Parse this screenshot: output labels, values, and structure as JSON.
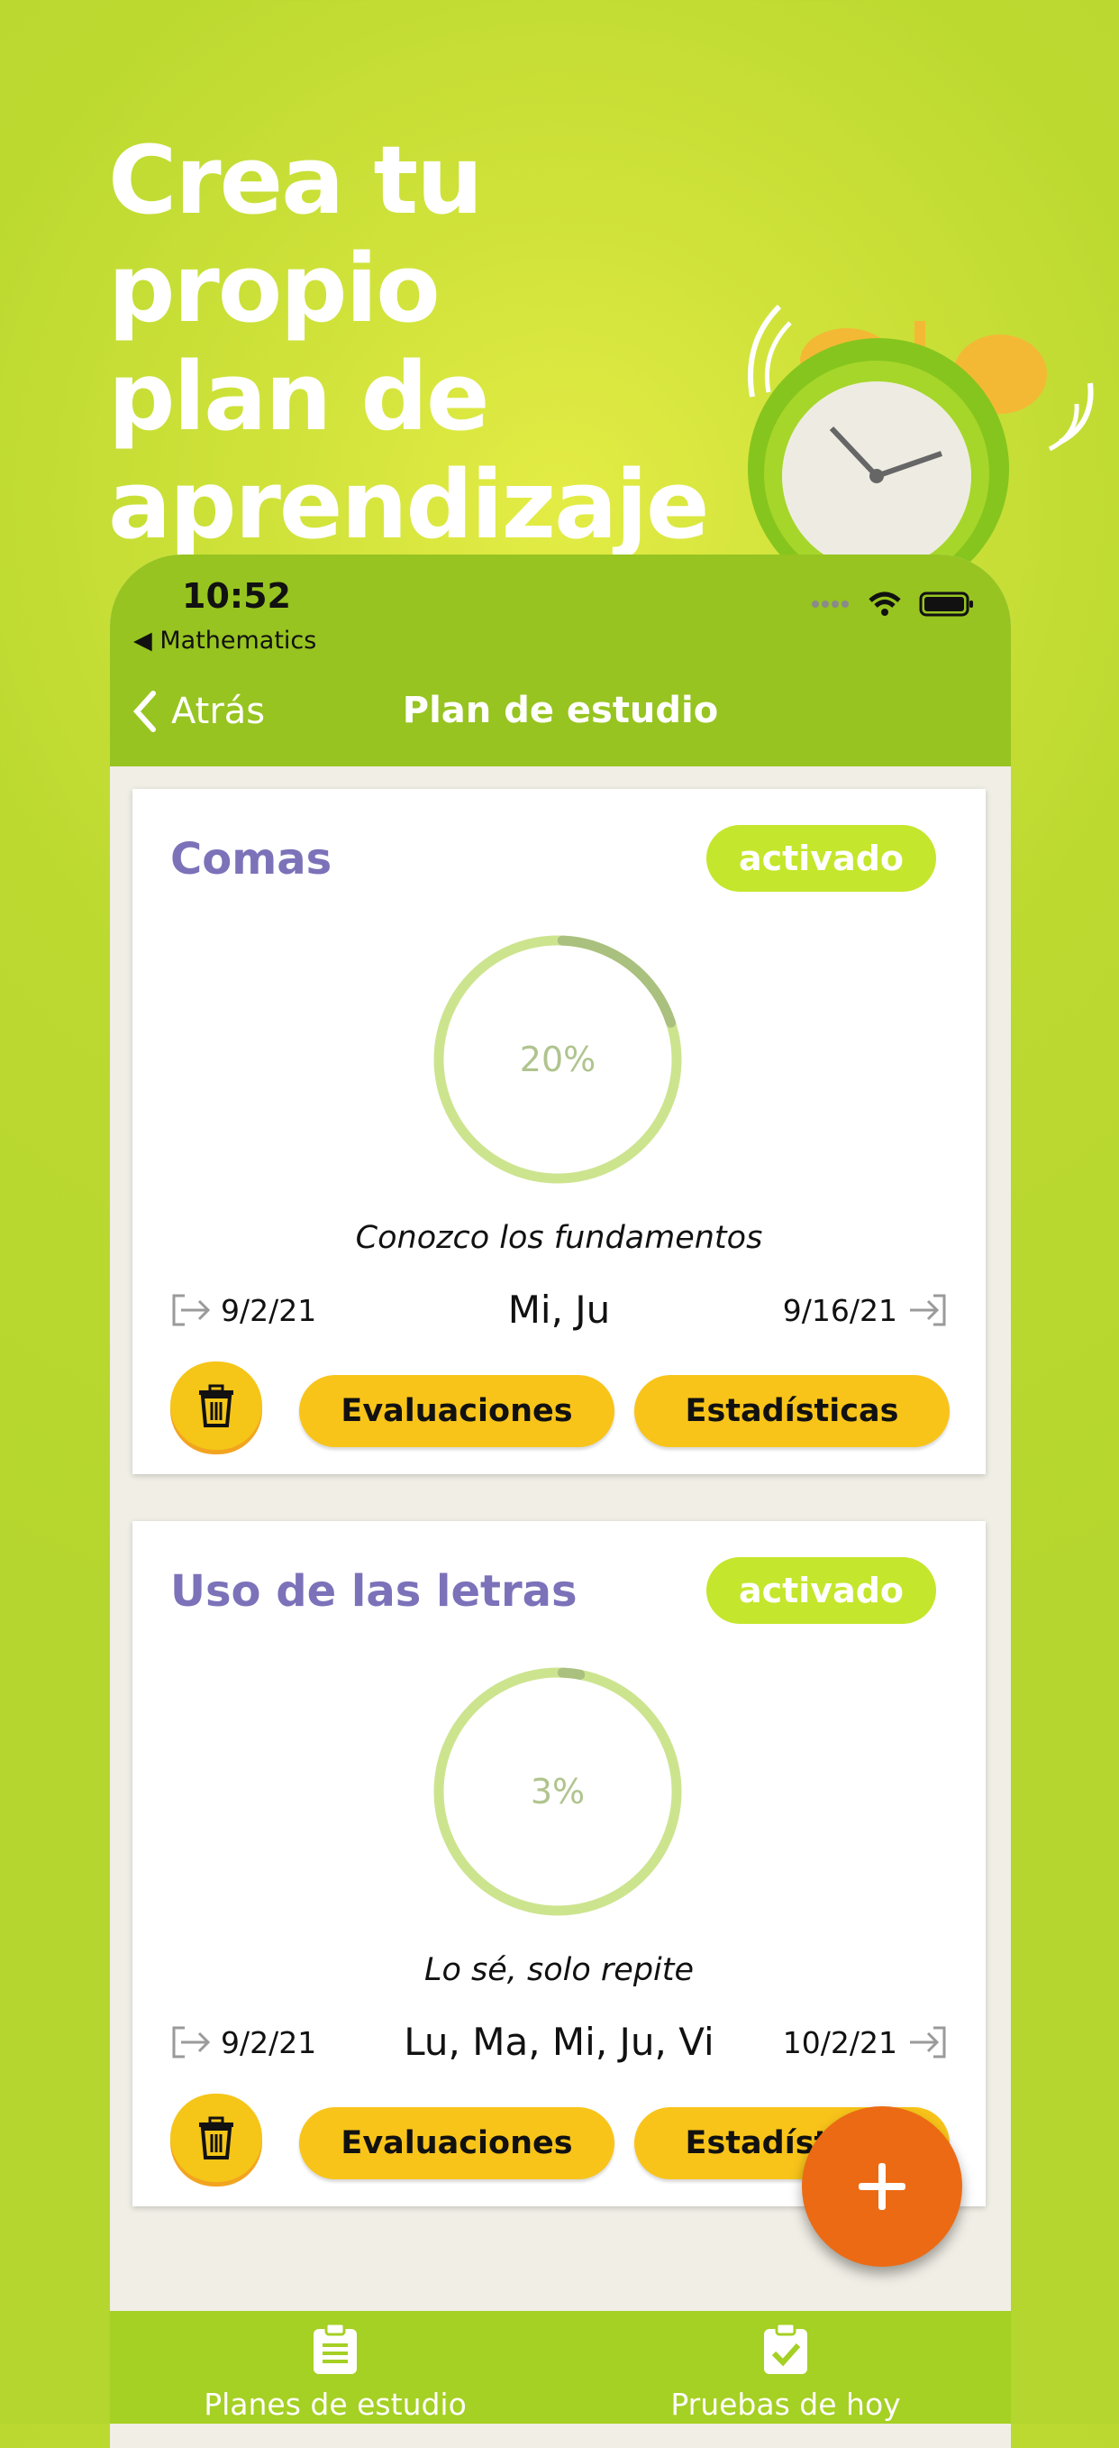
{
  "headline": {
    "line1": "Crea tu propio",
    "line2": "plan de",
    "line3": "aprendizaje"
  },
  "status_bar": {
    "time": "10:52",
    "back_app": "◀ Mathematics"
  },
  "nav": {
    "back_label": "Atrás",
    "title": "Plan de estudio"
  },
  "plans": [
    {
      "title": "Comas",
      "status": "activado",
      "progress_percent": 20,
      "progress_label": "20%",
      "level": "Conozco los fundamentos",
      "start_date": "9/2/21",
      "days": "Mi, Ju",
      "end_date": "9/16/21",
      "evaluations_label": "Evaluaciones",
      "stats_label": "Estadísticas"
    },
    {
      "title": "Uso de las letras",
      "status": "activado",
      "progress_percent": 3,
      "progress_label": "3%",
      "level": "Lo sé, solo repite",
      "start_date": "9/2/21",
      "days": "Lu, Ma, Mi, Ju, Vi",
      "end_date": "10/2/21",
      "evaluations_label": "Evaluaciones",
      "stats_label": "Estadísticas"
    }
  ],
  "tabbar": {
    "tab1": "Planes de estudio",
    "tab2": "Pruebas de hoy"
  },
  "colors": {
    "background": "#bcd930",
    "header": "#97c420",
    "title_purple": "#7b72b9",
    "badge": "#c4e62c",
    "button_yellow": "#f8c41a",
    "fab_orange": "#ec6a14",
    "ring_track": "#cde48f",
    "ring_progress": "#a9c07f"
  }
}
